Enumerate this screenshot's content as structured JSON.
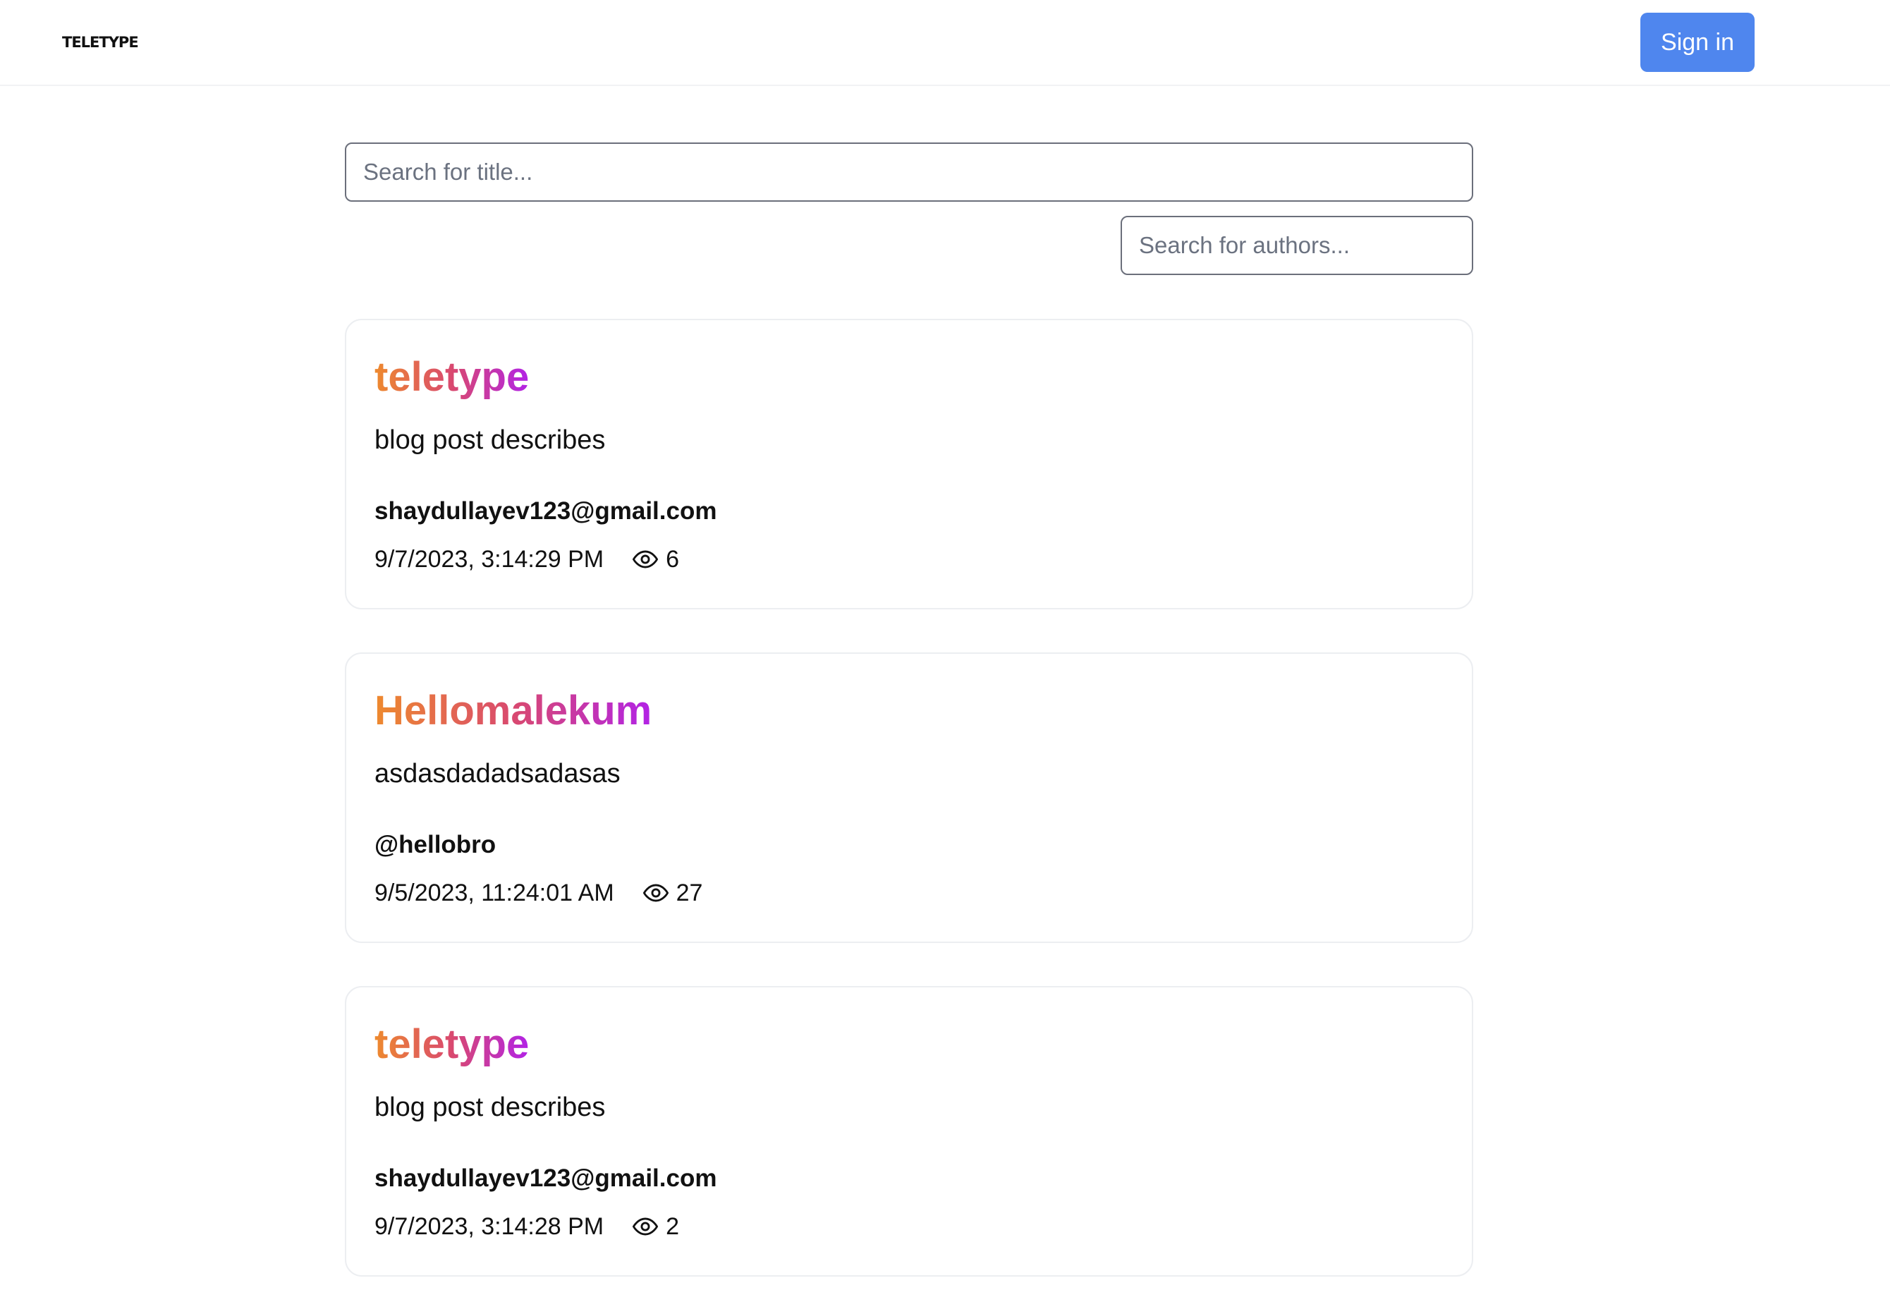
{
  "header": {
    "logo": "teletype",
    "signin_label": "Sign in"
  },
  "search": {
    "title_placeholder": "Search for title...",
    "authors_placeholder": "Search for authors..."
  },
  "colors": {
    "accent": "#4f86ee",
    "title_gradient": [
      "#ee8a2e",
      "#d9496f",
      "#b223e6"
    ]
  },
  "posts": [
    {
      "title": "teletype",
      "description": "blog post describes",
      "author": "shaydullayev123@gmail.com",
      "date": "9/7/2023, 3:14:29 PM",
      "views": "6",
      "views_icon": "eye-icon"
    },
    {
      "title": "Hellomalekum",
      "description": "asdasdadadsadasas",
      "author": "@hellobro",
      "date": "9/5/2023, 11:24:01 AM",
      "views": "27",
      "views_icon": "eye-icon"
    },
    {
      "title": "teletype",
      "description": "blog post describes",
      "author": "shaydullayev123@gmail.com",
      "date": "9/7/2023, 3:14:28 PM",
      "views": "2",
      "views_icon": "eye-icon"
    }
  ]
}
